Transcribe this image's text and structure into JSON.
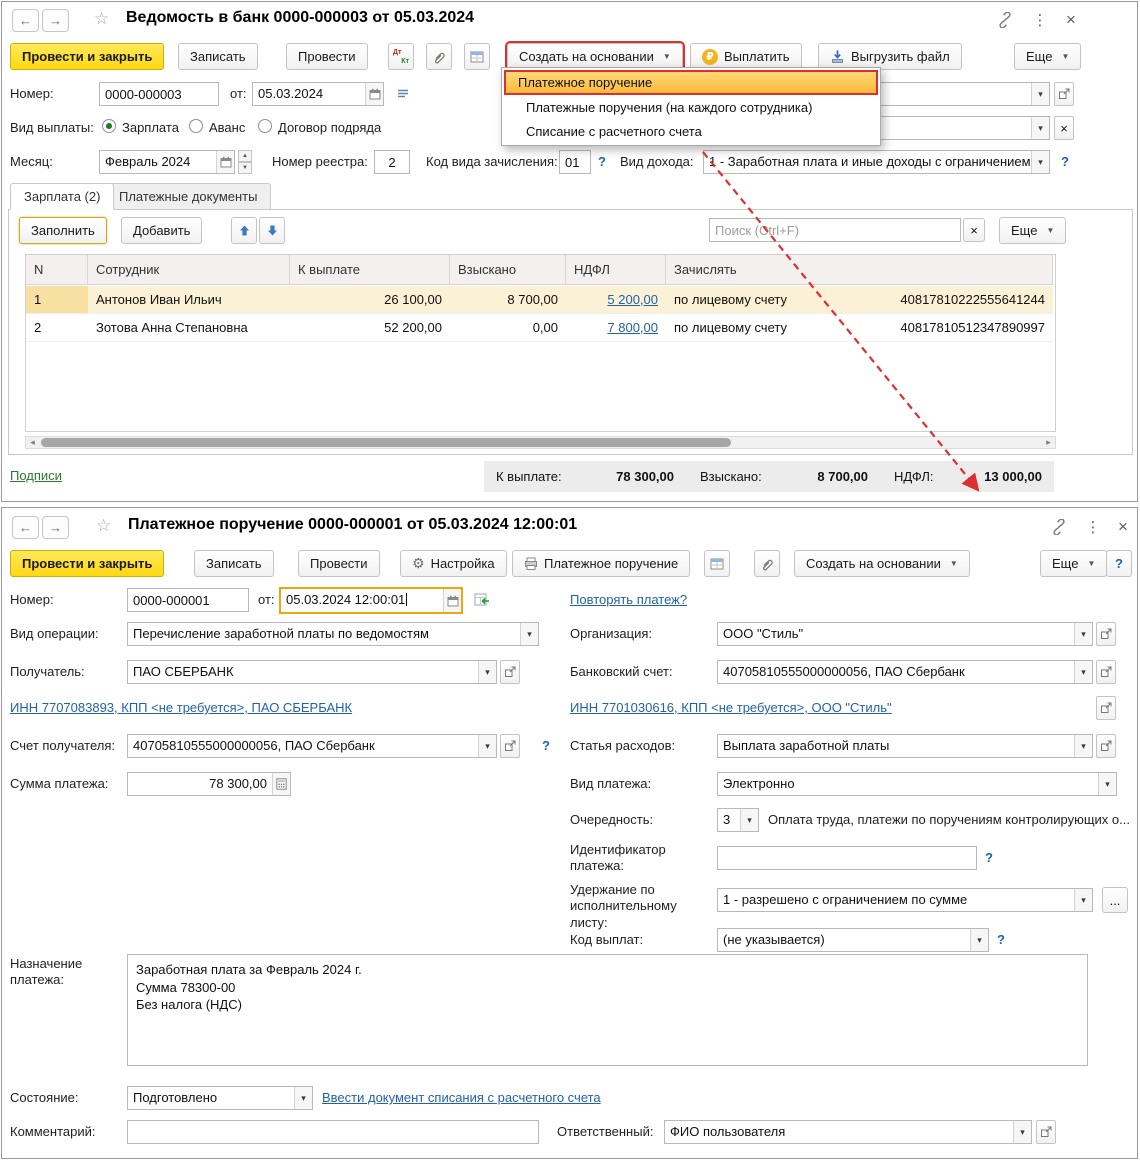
{
  "w1": {
    "title": "Ведомость в банк 0000-000003 от 05.03.2024",
    "tb": {
      "close": "Провести и закрыть",
      "save": "Записать",
      "post": "Провести",
      "create": "Создать на основании",
      "pay": "Выплатить",
      "upload": "Выгрузить файл",
      "more": "Еще"
    },
    "f": {
      "number_label": "Номер:",
      "number": "0000-000003",
      "date_label": "от:",
      "date": "05.03.2024",
      "paytype_label": "Вид выплаты:",
      "r1": "Зарплата",
      "r2": "Аванс",
      "r3": "Договор подряда",
      "month_label": "Месяц:",
      "month": "Февраль 2024",
      "reg_label": "Номер реестра:",
      "reg": "2",
      "code_label": "Код вида зачисления:",
      "code": "01",
      "income_label": "Вид дохода:",
      "income": "1 - Заработная плата и иные доходы с ограничением",
      "help": "?"
    },
    "tabs": {
      "t1": "Зарплата (2)",
      "t2": "Платежные документы"
    },
    "grid_tb": {
      "fill": "Заполнить",
      "add": "Добавить",
      "search_ph": "Поиск (Ctrl+F)",
      "more": "Еще"
    },
    "table": {
      "headers": [
        "N",
        "Сотрудник",
        "К выплате",
        "Взыскано",
        "НДФЛ",
        "Зачислять"
      ],
      "rows": [
        {
          "n": "1",
          "name": "Антонов Иван Ильич",
          "amount": "26 100,00",
          "collected": "8 700,00",
          "ndfl": "5 200,00",
          "credit": "по лицевому счету",
          "account": "40817810222555641244"
        },
        {
          "n": "2",
          "name": "Зотова Анна Степановна",
          "amount": "52 200,00",
          "collected": "0,00",
          "ndfl": "7 800,00",
          "credit": "по лицевому счету",
          "account": "40817810512347890997"
        }
      ]
    },
    "menu": {
      "items": [
        "Платежное поручение",
        "Платежные поручения (на каждого сотрудника)",
        "Списание с расчетного счета"
      ]
    },
    "footer": {
      "signs": "Подписи",
      "total1_label": "К выплате:",
      "total1": "78 300,00",
      "total2_label": "Взыскано:",
      "total2": "8 700,00",
      "total3_label": "НДФЛ:",
      "total3": "13 000,00"
    }
  },
  "w2": {
    "title": "Платежное поручение 0000-000001 от 05.03.2024 12:00:01",
    "tb": {
      "close": "Провести и закрыть",
      "save": "Записать",
      "post": "Провести",
      "settings": "Настройка",
      "print": "Платежное поручение",
      "create": "Создать на основании",
      "more": "Еще",
      "help": "?"
    },
    "f": {
      "number_label": "Номер:",
      "number": "0000-000001",
      "date_label": "от:",
      "date": "05.03.2024 12:00:01",
      "repeat_link": "Повторять платеж?",
      "optype_label": "Вид операции:",
      "optype": "Перечисление заработной платы по ведомостям",
      "org_label": "Организация:",
      "org": "ООО \"Стиль\"",
      "recipient_label": "Получатель:",
      "recipient": "ПАО СБЕРБАНК",
      "bank_label": "Банковский счет:",
      "bank": "40705810555000000056, ПАО Сбербанк",
      "inn_left": "ИНН 7707083893, КПП <не требуется>, ПАО СБЕРБАНК",
      "inn_right": "ИНН 7701030616, КПП <не требуется>, ООО \"Стиль\"",
      "acct_label": "Счет получателя:",
      "acct": "40705810555000000056, ПАО Сбербанк",
      "expense_label": "Статья расходов:",
      "expense": "Выплата заработной платы",
      "sum_label": "Сумма платежа:",
      "sum": "78 300,00",
      "ptype_label": "Вид платежа:",
      "ptype": "Электронно",
      "priority_label": "Очередность:",
      "priority": "3",
      "priority_note": "Оплата труда, платежи по поручениям контролирующих о...",
      "payid_label": "Идентификатор платежа:",
      "withhold_label": "Удержание по исполнительному листу:",
      "withhold": "1 - разрешено с ограничением по сумме",
      "paycode_label": "Код выплат:",
      "paycode": "(не указывается)",
      "purpose_label": "Назначение платежа:",
      "purpose": "Заработная плата за Февраль 2024 г.\nСумма 78300-00\nБез налога (НДС)",
      "state_label": "Состояние:",
      "state": "Подготовлено",
      "writeoff_link": "Ввести документ списания с расчетного счета",
      "comment_label": "Комментарий:",
      "resp_label": "Ответственный:",
      "resp": "ФИО пользователя",
      "ellipsis": "...",
      "help": "?"
    }
  }
}
